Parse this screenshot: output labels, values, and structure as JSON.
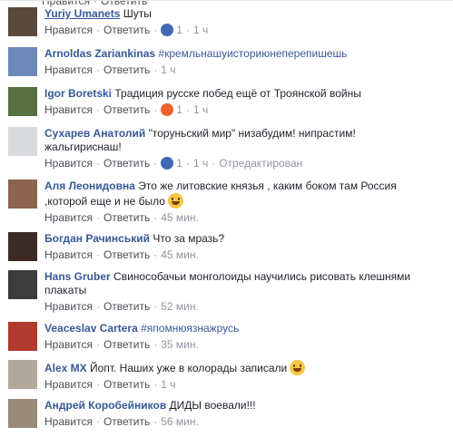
{
  "top_partial": {
    "like": "Нравится",
    "reply": "Ответить"
  },
  "common": {
    "like": "Нравится",
    "reply": "Ответить",
    "edited": "Отредактирован"
  },
  "comments": [
    {
      "author": "Yuriy Umanets",
      "text": "Шуты",
      "reaction_count": "1",
      "time": "1 ч",
      "reaction": "like",
      "avatar_color": "#5a4a3c"
    },
    {
      "author": "Arnoldas Zariankinas",
      "text": "#кремльнашуисториюнеперепишешь",
      "time": "1 ч",
      "avatar_color": "#6b88b8"
    },
    {
      "author": "Igor Boretski",
      "text": "Традиция русске побед ещё от Троянской войны",
      "reaction_count": "1",
      "time": "1 ч",
      "reaction": "angry",
      "avatar_color": "#587040"
    },
    {
      "author": "Сухарев Анатолий",
      "text_lines": [
        "\"торуньский мир\" низабудим! нипрастим!",
        "жальгириснаш!"
      ],
      "reaction_count": "1",
      "time": "1 ч",
      "reaction": "like",
      "avatar_color": "#d9dadd"
    },
    {
      "author": "Аля Леонидовна",
      "text_lines": [
        "Это же литовские князья , каким боком там Россия",
        ",которой еще и не было"
      ],
      "emoji": "grinning-emoji",
      "time": "45 мин.",
      "avatar_color": "#8c6450"
    },
    {
      "author": "Богдан Рачинський",
      "text": "Что за мразь?",
      "time": "45 мин.",
      "avatar_color": "#3a2c24"
    },
    {
      "author": "Hans Gruber",
      "text_lines": [
        "Свинособачьи монголоиды научились рисовать клешнями",
        "плакаты"
      ],
      "time": "52 мин.",
      "avatar_color": "#3c3c3c"
    },
    {
      "author": "Veaceslav Cartera",
      "text": "#япомнюязнажрусь",
      "time": "35 мин.",
      "avatar_color": "#b03a2e"
    },
    {
      "author": "Alex MX",
      "text": "Йопт. Наших уже в колорады записали",
      "emoji": "grinning-emoji",
      "time": "1 ч",
      "avatar_color": "#b0a89a"
    },
    {
      "author": "Андрей Коробейников",
      "text": "ДИДЫ воевали!!!",
      "time": "56 мин.",
      "avatar_color": "#9a8a7a"
    }
  ]
}
